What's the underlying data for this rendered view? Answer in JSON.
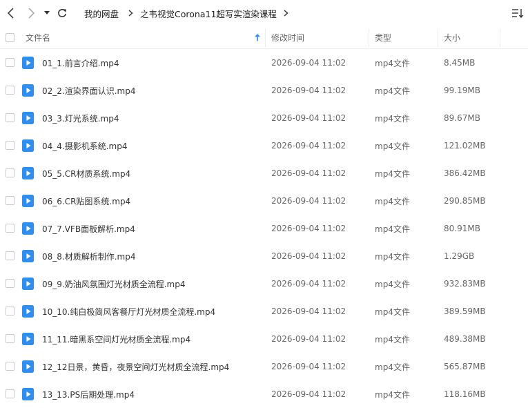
{
  "toolbar": {
    "back_icon": "chevron-left-icon",
    "forward_icon": "chevron-right-icon",
    "dropdown_icon": "caret-down-icon",
    "refresh_icon": "refresh-icon",
    "view_toggle_icon": "sort-list-icon"
  },
  "breadcrumb": {
    "root": "我的网盘",
    "current": "之韦视觉Corona11超写实渲染课程"
  },
  "columns": {
    "name": "文件名",
    "modified": "修改时间",
    "type": "类型",
    "size": "大小"
  },
  "colors": {
    "accent": "#2f8ef0",
    "file_icon": "#2f8ef0"
  },
  "files": [
    {
      "name": "01_1.前言介绍.mp4",
      "modified": "2026-09-04 11:02",
      "type": "mp4文件",
      "size": "8.45MB"
    },
    {
      "name": "02_2.渲染界面认识.mp4",
      "modified": "2026-09-04 11:02",
      "type": "mp4文件",
      "size": "99.19MB"
    },
    {
      "name": "03_3.灯光系统.mp4",
      "modified": "2026-09-04 11:02",
      "type": "mp4文件",
      "size": "89.67MB"
    },
    {
      "name": "04_4.摄影机系统.mp4",
      "modified": "2026-09-04 11:02",
      "type": "mp4文件",
      "size": "121.02MB"
    },
    {
      "name": "05_5.CR材质系统.mp4",
      "modified": "2026-09-04 11:02",
      "type": "mp4文件",
      "size": "386.42MB"
    },
    {
      "name": "06_6.CR贴图系统.mp4",
      "modified": "2026-09-04 11:02",
      "type": "mp4文件",
      "size": "290.85MB"
    },
    {
      "name": "07_7.VFB面板解析.mp4",
      "modified": "2026-09-04 11:02",
      "type": "mp4文件",
      "size": "80.91MB"
    },
    {
      "name": "08_8.材质解析制作.mp4",
      "modified": "2026-09-04 11:02",
      "type": "mp4文件",
      "size": "1.29GB"
    },
    {
      "name": "09_9.奶油风氛围灯光材质全流程.mp4",
      "modified": "2026-09-04 11:02",
      "type": "mp4文件",
      "size": "932.83MB"
    },
    {
      "name": "10_10.纯白极简风客餐厅灯光材质全流程.mp4",
      "modified": "2026-09-04 11:02",
      "type": "mp4文件",
      "size": "389.59MB"
    },
    {
      "name": "11_11.暗黑系空间灯光材质全流程.mp4",
      "modified": "2026-09-04 11:02",
      "type": "mp4文件",
      "size": "489.38MB"
    },
    {
      "name": "12_12日景，黄昏，夜景空间灯光材质全流程.mp4",
      "modified": "2026-09-04 11:02",
      "type": "mp4文件",
      "size": "565.87MB"
    },
    {
      "name": "13_13.PS后期处理.mp4",
      "modified": "2026-09-04 11:02",
      "type": "mp4文件",
      "size": "118.16MB"
    }
  ]
}
